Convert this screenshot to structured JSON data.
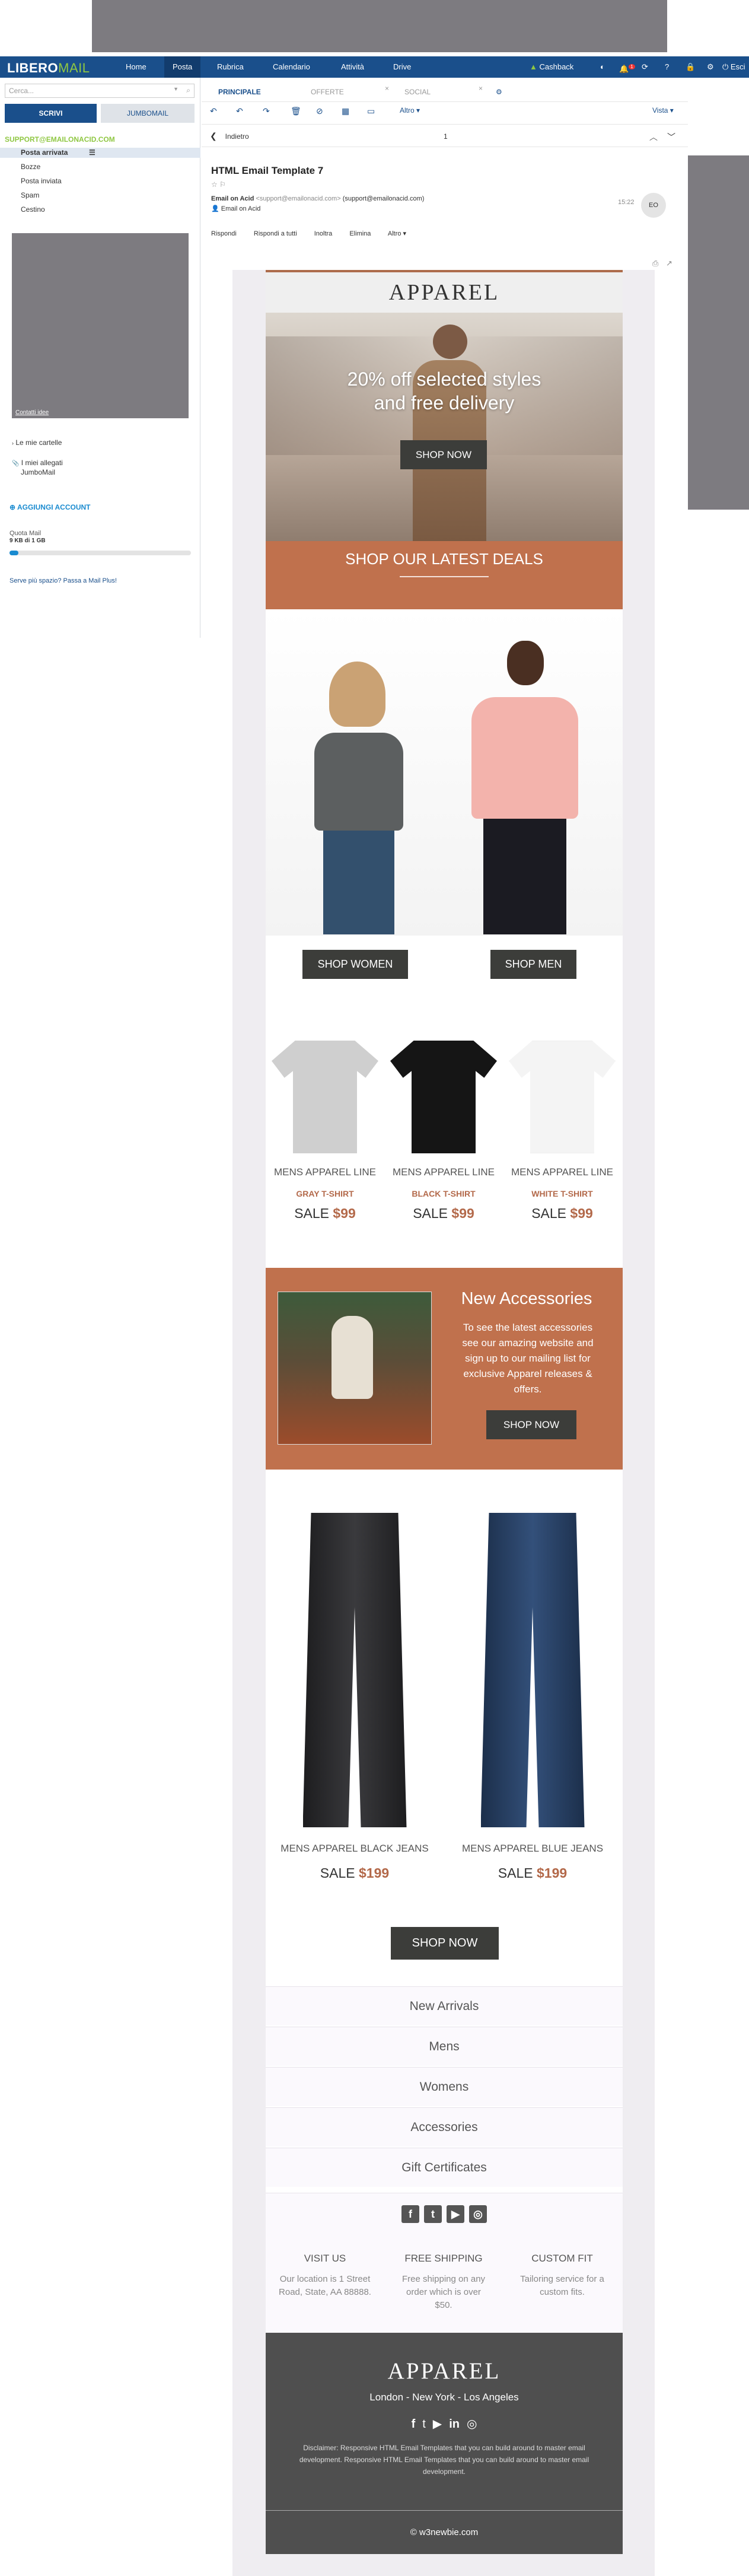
{
  "topbar": {
    "logo_main": "LIBERO",
    "logo_accent": "MAIL",
    "items": [
      "Home",
      "Posta",
      "Rubrica",
      "Calendario",
      "Attività",
      "Drive"
    ],
    "cashback": "Cashback",
    "logout": "Esci",
    "notif_count": "1"
  },
  "sidebar": {
    "search_placeholder": "Cerca...",
    "write": "SCRIVI",
    "jumbo": "JUMBOMAIL",
    "account": "SUPPORT@EMAILONACID.COM",
    "folders": [
      "Posta arrivata",
      "Bozze",
      "Posta inviata",
      "Spam",
      "Cestino"
    ],
    "ad_label": "Contatti idee",
    "my_folders": "Le mie cartelle",
    "attachments": "I miei allegati",
    "jumbomail": "JumboMail",
    "add_account": "AGGIUNGI ACCOUNT",
    "quota_label": "Quota Mail",
    "quota_value": "9 KB di 1 GB",
    "upgrade": "Serve più spazio? Passa a Mail Plus!"
  },
  "tabs": [
    "PRINCIPALE",
    "OFFERTE",
    "SOCIAL"
  ],
  "toolbar": {
    "altro": "Altro",
    "vista": "Vista"
  },
  "nav": {
    "back": "Indietro",
    "count": "1"
  },
  "message": {
    "subject": "HTML Email Template 7",
    "from_name": "Email on Acid",
    "from_email": "<support@emailonacid.com>",
    "to": "(support@emailonacid.com)",
    "to_name": "Email on Acid",
    "time": "15:22",
    "avatar": "EO",
    "actions": [
      "Rispondi",
      "Rispondi a tutti",
      "Inoltra",
      "Elimina",
      "Altro"
    ]
  },
  "email": {
    "brand": "APPAREL",
    "hero_title": "20% off selected styles and free delivery",
    "hero_cta": "SHOP NOW",
    "deals": "SHOP OUR LATEST DEALS",
    "shop_women": "SHOP WOMEN",
    "shop_men": "SHOP MEN",
    "tshirts": [
      {
        "line": "MENS APPAREL LINE",
        "name": "GRAY T-SHIRT",
        "sale": "SALE",
        "price": "$99",
        "color": "#cfcfcf"
      },
      {
        "line": "MENS APPAREL LINE",
        "name": "BLACK T-SHIRT",
        "sale": "SALE",
        "price": "$99",
        "color": "#151515"
      },
      {
        "line": "MENS APPAREL LINE",
        "name": "WHITE T-SHIRT",
        "sale": "SALE",
        "price": "$99",
        "color": "#fafafa"
      }
    ],
    "accessories_title": "New Accessories",
    "accessories_text": "To see the latest accessories see our amazing website and sign up to our mailing list for exclusive Apparel releases & offers.",
    "accessories_cta": "SHOP NOW",
    "jeans": [
      {
        "name": "MENS APPAREL BLACK JEANS",
        "sale": "SALE",
        "price": "$199",
        "color": "#2b2b2d"
      },
      {
        "name": "MENS APPAREL BLUE JEANS",
        "sale": "SALE",
        "price": "$199",
        "color": "#243a5c"
      }
    ],
    "jeans_cta": "SHOP NOW",
    "links": [
      "New Arrivals",
      "Mens",
      "Womens",
      "Accessories",
      "Gift Certificates"
    ],
    "info": [
      {
        "title": "VISIT US",
        "text": "Our location is 1 Street Road, State, AA 88888."
      },
      {
        "title": "FREE SHIPPING",
        "text": "Free shipping on any order which is over $50."
      },
      {
        "title": "CUSTOM FIT",
        "text": "Tailoring service for a custom fits."
      }
    ],
    "footer_brand": "APPAREL",
    "footer_cities": "London - New York - Los Angeles",
    "disclaimer": "Disclaimer: Responsive HTML Email Templates that you can build around to master email development. Responsive HTML Email Templates that you can build around to master email development.",
    "copyright": "© w3newbie.com"
  }
}
